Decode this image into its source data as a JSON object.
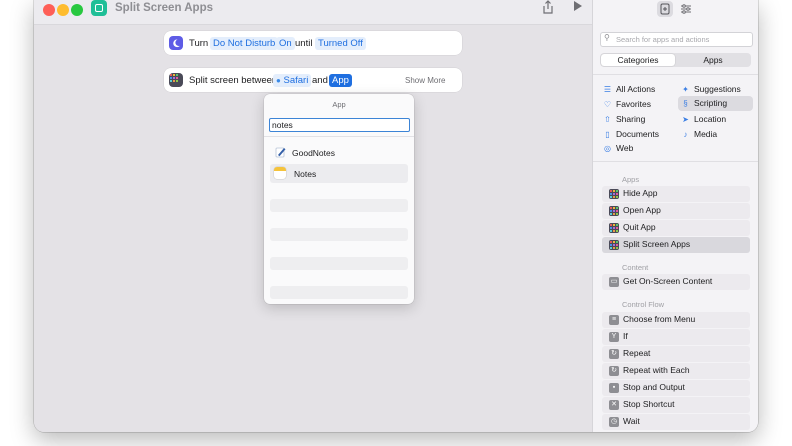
{
  "window": {
    "title": "Split Screen Apps",
    "traffic_lights": [
      "#fe5f57",
      "#febc2e",
      "#28c840"
    ],
    "share_icon": "share-icon",
    "run_icon": "play-icon"
  },
  "actions": [
    {
      "prefix": "Turn",
      "mode": "Do Not Disturb",
      "state": "On",
      "until": "until",
      "until_value": "Turned Off"
    },
    {
      "prefix": "Split screen between",
      "app1": "Safari",
      "and": "and",
      "app2": "App",
      "show_more": "Show More"
    }
  ],
  "popover": {
    "title": "App",
    "search_value": "notes",
    "results": [
      {
        "name": "GoodNotes",
        "icon": "goodnotes-icon"
      },
      {
        "name": "Notes",
        "icon": "notes-icon"
      }
    ]
  },
  "sidebar": {
    "search_placeholder": "Search for apps and actions",
    "segments": [
      "Categories",
      "Apps"
    ],
    "selected_segment": "Categories",
    "categories_left": [
      {
        "label": "All Actions",
        "icon": "list-icon"
      },
      {
        "label": "Favorites",
        "icon": "heart-icon"
      },
      {
        "label": "Sharing",
        "icon": "share-icon"
      },
      {
        "label": "Documents",
        "icon": "document-icon"
      },
      {
        "label": "Web",
        "icon": "compass-icon"
      }
    ],
    "categories_right": [
      {
        "label": "Suggestions",
        "icon": "sparkle-icon"
      },
      {
        "label": "Scripting",
        "icon": "scripting-icon",
        "selected": true
      },
      {
        "label": "Location",
        "icon": "location-arrow-icon"
      },
      {
        "label": "Media",
        "icon": "music-note-icon"
      }
    ],
    "sections": [
      {
        "title": "Apps",
        "items": [
          {
            "label": "Hide App",
            "icon": "app-grid-icon"
          },
          {
            "label": "Open App",
            "icon": "app-grid-icon"
          },
          {
            "label": "Quit App",
            "icon": "app-grid-icon"
          },
          {
            "label": "Split Screen Apps",
            "icon": "app-grid-icon",
            "selected": true
          }
        ]
      },
      {
        "title": "Content",
        "items": [
          {
            "label": "Get On-Screen Content",
            "icon": "screen-content-icon"
          }
        ]
      },
      {
        "title": "Control Flow",
        "items": [
          {
            "label": "Choose from Menu",
            "icon": "menu-icon"
          },
          {
            "label": "If",
            "icon": "if-icon"
          },
          {
            "label": "Repeat",
            "icon": "repeat-icon"
          },
          {
            "label": "Repeat with Each",
            "icon": "repeat-each-icon"
          },
          {
            "label": "Stop and Output",
            "icon": "stop-output-icon"
          },
          {
            "label": "Stop Shortcut",
            "icon": "stop-icon"
          },
          {
            "label": "Wait",
            "icon": "wait-icon"
          }
        ]
      }
    ]
  },
  "colors": {
    "accent": "#1f6fe0",
    "token_bg": "#e4eefc",
    "dnd_icon": "#5e5ce6",
    "app_icon": "#1fbf97"
  }
}
